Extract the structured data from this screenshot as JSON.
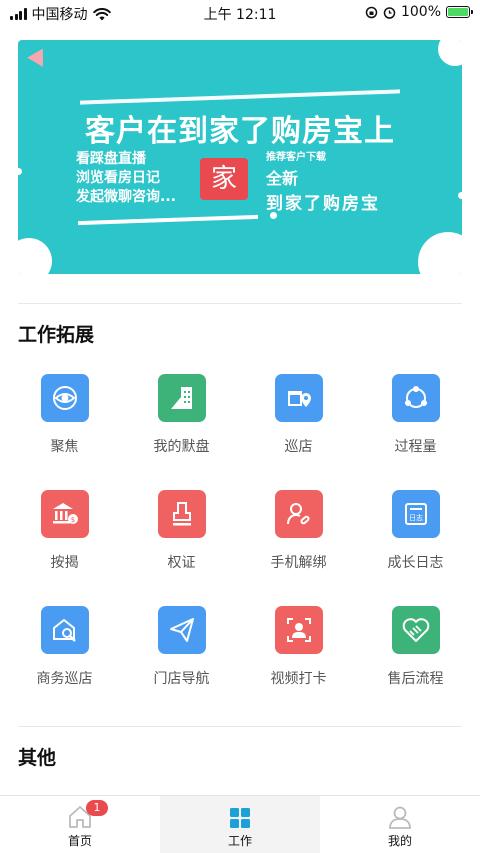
{
  "status_bar": {
    "carrier": "中国移动",
    "time": "上午 12:11",
    "battery": "100%"
  },
  "banner": {
    "title": "客户在到家了购房宝上",
    "left_lines": [
      "看踩盘直播",
      "浏览看房日记",
      "发起微聊咨询..."
    ],
    "center_char": "家",
    "right_small": "推荐客户下载",
    "right_mid": "全新",
    "right_big": "到家了购房宝",
    "colors": {
      "background": "#2bc5ca",
      "badge": "#e84a4f"
    }
  },
  "sections": {
    "work": "工作拓展",
    "other": "其他"
  },
  "tiles": [
    {
      "label": "聚焦",
      "icon": "focus-eye-icon",
      "color": "#4a9cf2"
    },
    {
      "label": "我的默盘",
      "icon": "building-icon",
      "color": "#3db37a"
    },
    {
      "label": "巡店",
      "icon": "shop-location-icon",
      "color": "#4a9cf2"
    },
    {
      "label": "过程量",
      "icon": "process-cycle-icon",
      "color": "#4a9cf2"
    },
    {
      "label": "按揭",
      "icon": "bank-icon",
      "color": "#f06262"
    },
    {
      "label": "权证",
      "icon": "stamp-icon",
      "color": "#f06262"
    },
    {
      "label": "手机解绑",
      "icon": "user-unlink-icon",
      "color": "#f06262"
    },
    {
      "label": "成长日志",
      "icon": "log-book-icon",
      "color": "#4a9cf2"
    },
    {
      "label": "商务巡店",
      "icon": "house-search-icon",
      "color": "#4a9cf2"
    },
    {
      "label": "门店导航",
      "icon": "paper-plane-icon",
      "color": "#4a9cf2"
    },
    {
      "label": "视频打卡",
      "icon": "face-frame-icon",
      "color": "#f06262"
    },
    {
      "label": "售后流程",
      "icon": "handshake-heart-icon",
      "color": "#3db37a"
    }
  ],
  "tabbar": {
    "home": {
      "label": "首页",
      "badge": "1"
    },
    "work": {
      "label": "工作"
    },
    "mine": {
      "label": "我的"
    }
  }
}
